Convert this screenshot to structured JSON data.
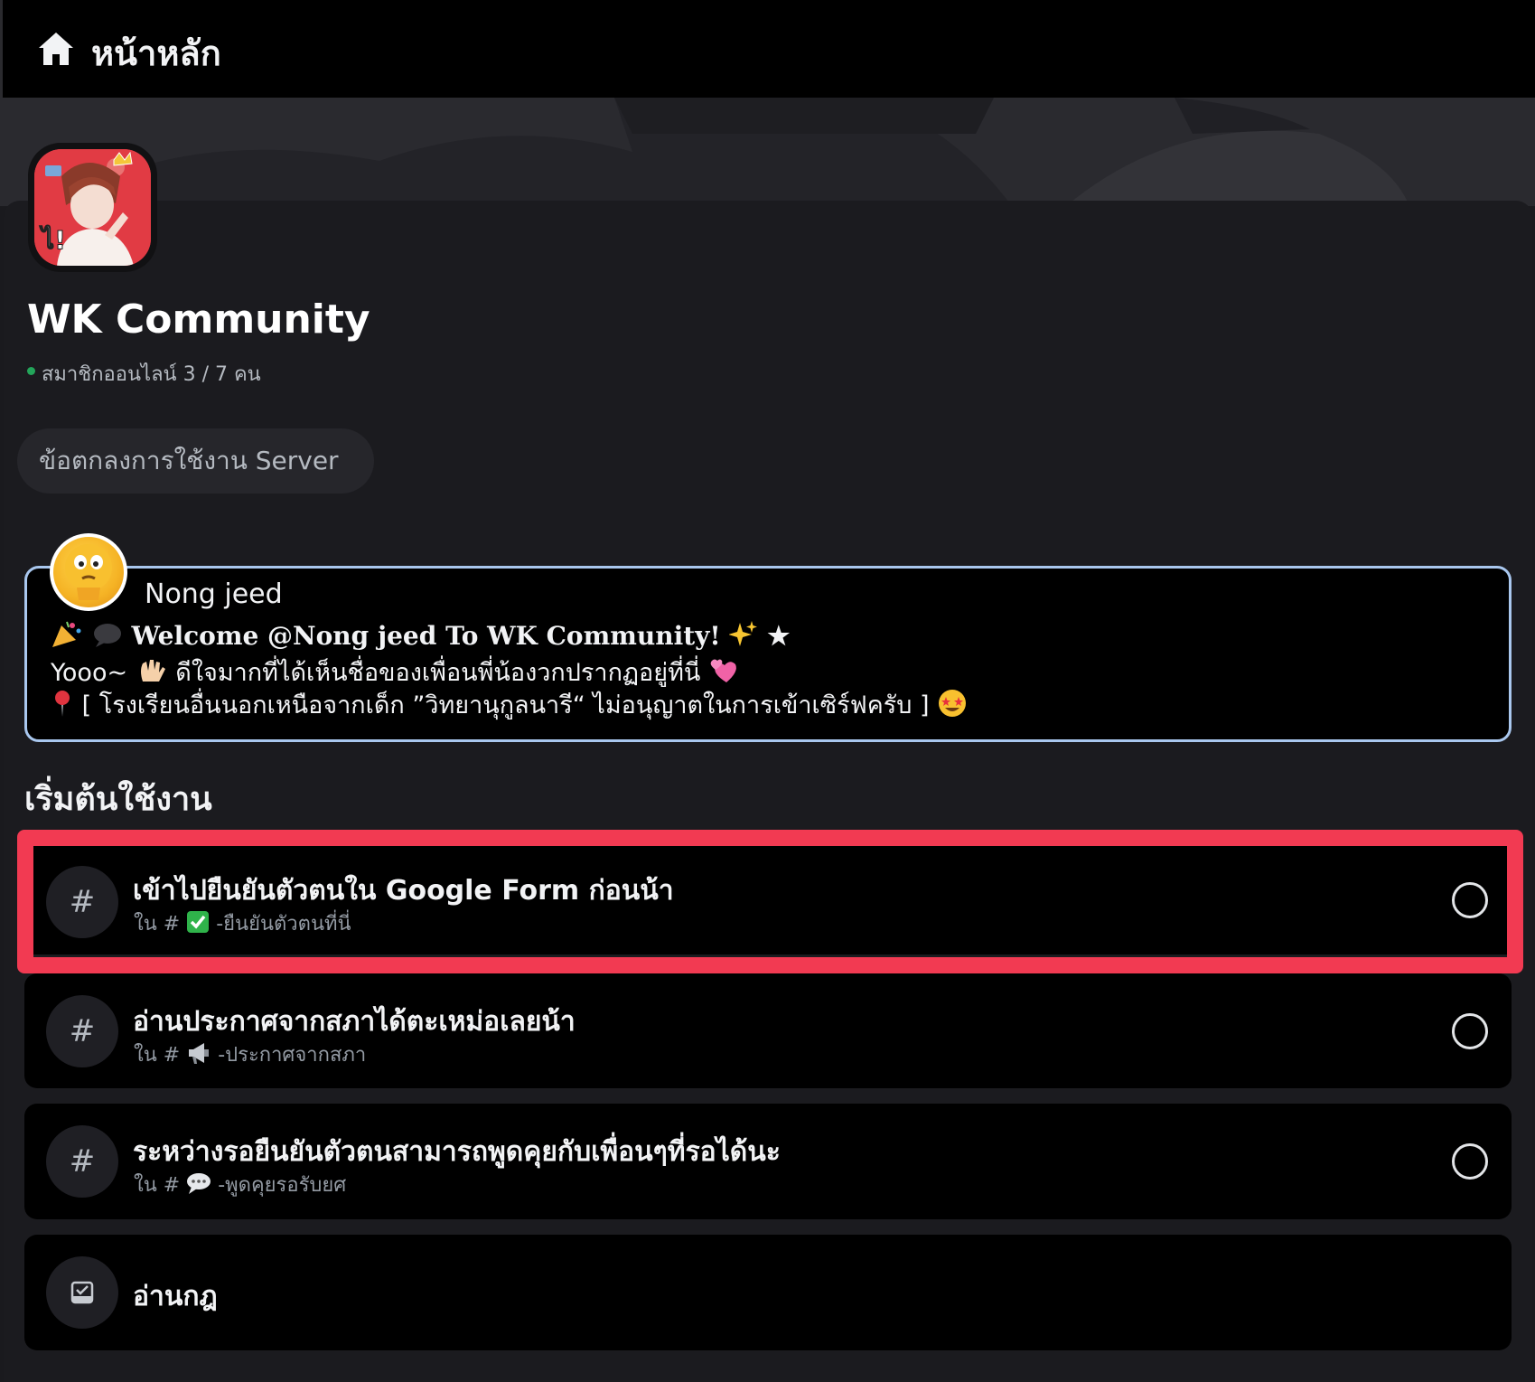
{
  "header": {
    "title": "หน้าหลัก",
    "icon": "home-icon"
  },
  "server": {
    "name": "WK Community",
    "online_text": "สมาชิกออนไลน์ 3 / 7 คน",
    "rules_button": "ข้อตกลงการใช้งาน Server"
  },
  "welcome": {
    "user": "Nong jeed",
    "line1": "Welcome @Nong jeed To WK Community!",
    "line1_suffix": "★",
    "line2": "Yooo~",
    "line2_text": "ดีใจมากที่ได้เห็นชื่อของเพื่อนพี่น้องวกปรากฏอยู่ที่นี่",
    "line3": "[ โรงเรียนอื่นนอกเหนือจากเด็ก ”วิทยานุกูลนารี“ ไม่อนุญาตในการเข้าเซิร์ฟครับ ]"
  },
  "section": {
    "title": "เริ่มต้นใช้งาน"
  },
  "tasks": [
    {
      "title": "เข้าไปยืนยันตัวตนใน Google Form ก่อนน้า",
      "sub_prefix": "ใน #",
      "sub_suffix": "-ยืนยันตัวตนที่นี่",
      "icon": "#"
    },
    {
      "title": "อ่านประกาศจากสภาได้ตะเหม่อเลยน้า",
      "sub_prefix": "ใน #",
      "sub_suffix": "-ประกาศจากสภา",
      "icon": "#"
    },
    {
      "title": "ระหว่างรอยืนยันตัวตนสามารถพูดคุยกับเพื่อนๆที่รอได้นะ",
      "sub_prefix": "ใน #",
      "sub_suffix": "-พูดคุยรอรับยศ",
      "icon": "#"
    },
    {
      "title": "อ่านกฎ",
      "icon": "checklist-icon"
    }
  ],
  "colors": {
    "highlight": "#f23a52",
    "online": "#23a55a",
    "card_border": "#a9c7ee"
  }
}
